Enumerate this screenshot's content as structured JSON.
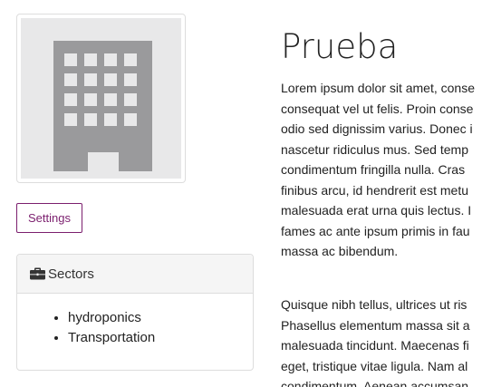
{
  "org": {
    "title": "Prueba",
    "image_icon": "building-icon"
  },
  "actions": {
    "settings_label": "Settings"
  },
  "sectors_panel": {
    "heading": "Sectors",
    "heading_icon": "briefcase-icon",
    "items": [
      "hydroponics",
      "Transportation"
    ]
  },
  "description": {
    "paragraph1": [
      "Lorem ipsum dolor sit amet, conse",
      "consequat vel ut felis. Proin conse",
      "odio sed dignissim varius. Donec i",
      "nascetur ridiculus mus. Sed temp",
      "condimentum fringilla nulla. Cras",
      "finibus arcu, id hendrerit est metu",
      "malesuada erat urna quis lectus. I",
      "fames ac ante ipsum primis in fau",
      "massa ac bibendum."
    ],
    "paragraph2": [
      "Quisque nibh tellus, ultrices ut ris",
      "Phasellus elementum massa sit a",
      "malesuada tincidunt. Maecenas fi",
      "eget, tristique vitae ligula. Nam al",
      "condimentum. Aenean accumsan"
    ]
  },
  "colors": {
    "accent": "#7b1f6e",
    "icon_gray": "#9a9a9c",
    "placeholder_bg": "#e8e8e9"
  }
}
